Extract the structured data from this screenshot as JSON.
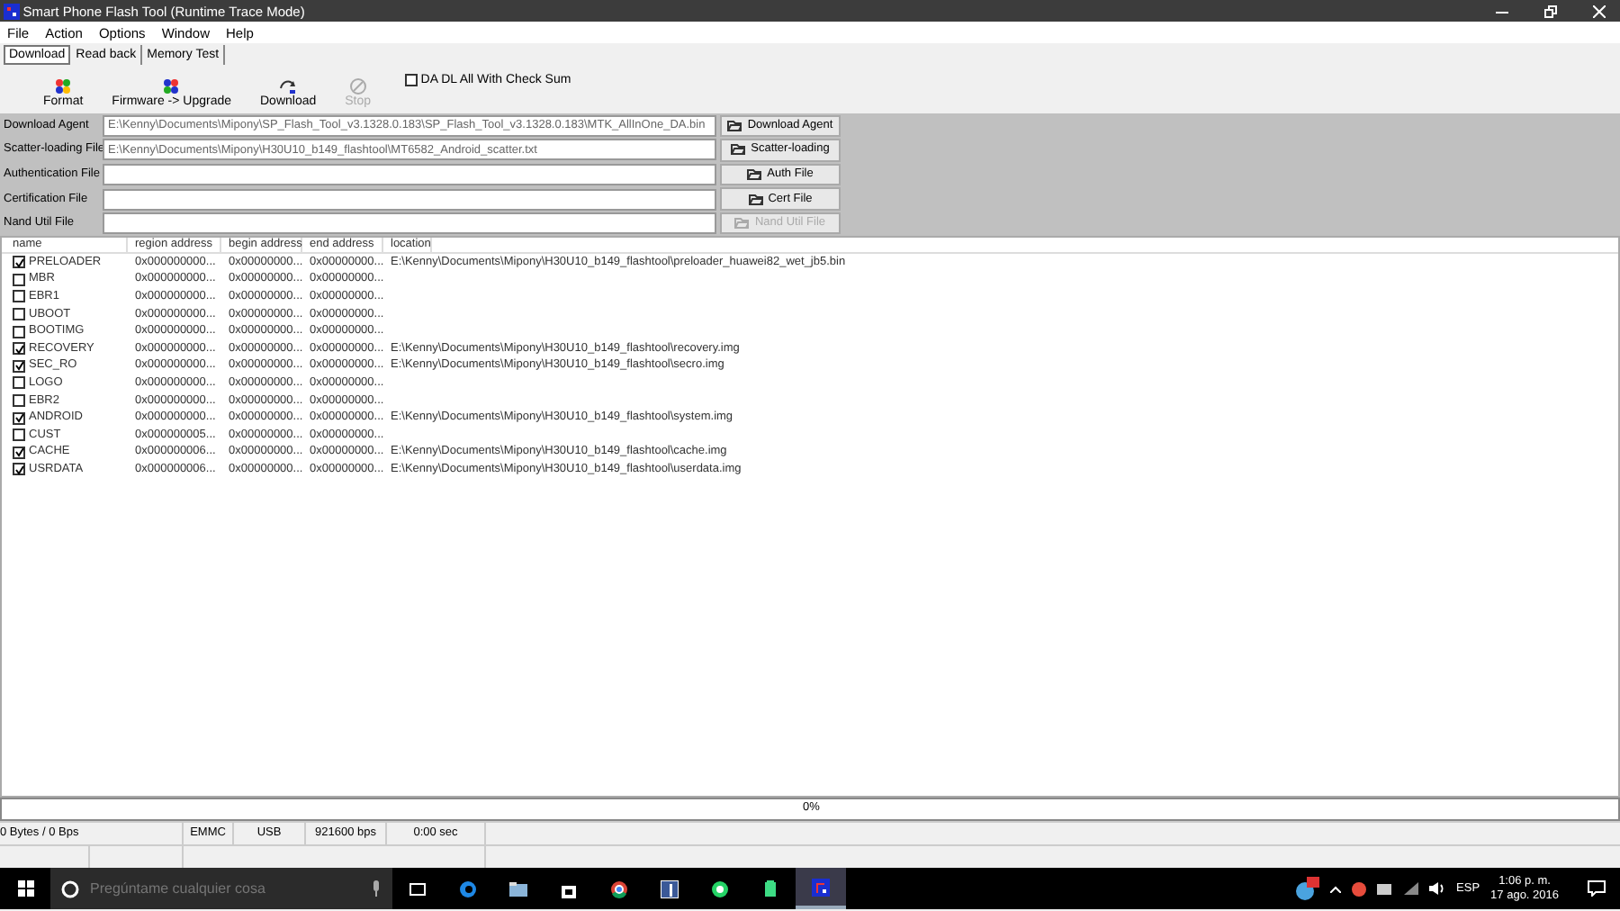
{
  "window": {
    "title": "Smart Phone Flash Tool (Runtime Trace Mode)"
  },
  "menu": [
    "File",
    "Action",
    "Options",
    "Window",
    "Help"
  ],
  "tabs": [
    {
      "label": "Download",
      "selected": true
    },
    {
      "label": "Read back",
      "selected": false
    },
    {
      "label": "Memory Test",
      "selected": false
    }
  ],
  "toolbar": [
    {
      "kind": "format",
      "label": "Format",
      "disabled": false
    },
    {
      "kind": "upgrade",
      "label": "Firmware -> Upgrade",
      "disabled": false
    },
    {
      "kind": "download",
      "label": "Download",
      "disabled": false
    },
    {
      "kind": "stop",
      "label": "Stop",
      "disabled": true
    }
  ],
  "checksum": {
    "label": "DA DL All With Check Sum",
    "checked": false
  },
  "files": [
    {
      "label": "Download Agent",
      "value": "E:\\Kenny\\Documents\\Mipony\\SP_Flash_Tool_v3.1328.0.183\\SP_Flash_Tool_v3.1328.0.183\\MTK_AllInOne_DA.bin",
      "button": "Download Agent",
      "disabled": false
    },
    {
      "label": "Scatter-loading File",
      "value": "E:\\Kenny\\Documents\\Mipony\\H30U10_b149_flashtool\\MT6582_Android_scatter.txt",
      "button": "Scatter-loading",
      "disabled": false
    },
    {
      "label": "Authentication File",
      "button": "Auth File",
      "disabled": false
    },
    {
      "label": "Certification File",
      "button": "Cert File",
      "disabled": false
    },
    {
      "label": "Nand Util File",
      "button": "Nand Util File",
      "disabled": true
    }
  ],
  "table": {
    "columns": [
      "name",
      "region address",
      "begin address",
      "end address",
      "location"
    ],
    "rows": [
      {
        "name": "PRELOADER",
        "checked": true,
        "region": "0x000000000...",
        "begin": "0x00000000...",
        "end": "0x00000000...",
        "location": "E:\\Kenny\\Documents\\Mipony\\H30U10_b149_flashtool\\preloader_huawei82_wet_jb5.bin"
      },
      {
        "name": "MBR",
        "checked": false,
        "region": "0x000000000...",
        "begin": "0x00000000...",
        "end": "0x00000000..."
      },
      {
        "name": "EBR1",
        "checked": false,
        "region": "0x000000000...",
        "begin": "0x00000000...",
        "end": "0x00000000..."
      },
      {
        "name": "UBOOT",
        "checked": false,
        "region": "0x000000000...",
        "begin": "0x00000000...",
        "end": "0x00000000..."
      },
      {
        "name": "BOOTIMG",
        "checked": false,
        "region": "0x000000000...",
        "begin": "0x00000000...",
        "end": "0x00000000..."
      },
      {
        "name": "RECOVERY",
        "checked": true,
        "region": "0x000000000...",
        "begin": "0x00000000...",
        "end": "0x00000000...",
        "location": "E:\\Kenny\\Documents\\Mipony\\H30U10_b149_flashtool\\recovery.img"
      },
      {
        "name": "SEC_RO",
        "checked": true,
        "region": "0x000000000...",
        "begin": "0x00000000...",
        "end": "0x00000000...",
        "location": "E:\\Kenny\\Documents\\Mipony\\H30U10_b149_flashtool\\secro.img"
      },
      {
        "name": "LOGO",
        "checked": false,
        "region": "0x000000000...",
        "begin": "0x00000000...",
        "end": "0x00000000..."
      },
      {
        "name": "EBR2",
        "checked": false,
        "region": "0x000000000...",
        "begin": "0x00000000...",
        "end": "0x00000000..."
      },
      {
        "name": "ANDROID",
        "checked": true,
        "region": "0x000000000...",
        "begin": "0x00000000...",
        "end": "0x00000000...",
        "location": "E:\\Kenny\\Documents\\Mipony\\H30U10_b149_flashtool\\system.img"
      },
      {
        "name": "CUST",
        "checked": false,
        "region": "0x000000005...",
        "begin": "0x00000000...",
        "end": "0x00000000..."
      },
      {
        "name": "CACHE",
        "checked": true,
        "region": "0x000000006...",
        "begin": "0x00000000...",
        "end": "0x00000000...",
        "location": "E:\\Kenny\\Documents\\Mipony\\H30U10_b149_flashtool\\cache.img"
      },
      {
        "name": "USRDATA",
        "checked": true,
        "region": "0x000000006...",
        "begin": "0x00000000...",
        "end": "0x00000000...",
        "location": "E:\\Kenny\\Documents\\Mipony\\H30U10_b149_flashtool\\userdata.img"
      }
    ]
  },
  "progress": {
    "reading": "0%"
  },
  "status_bar": [
    "0 Bytes / 0 Bps",
    "EMMC",
    "USB",
    "921600 bps",
    "0:00 sec"
  ],
  "taskbar": {
    "search": {
      "placeholder": "Pregúntame cualquier cosa"
    },
    "apps": [
      {
        "kind": "taskview",
        "active": false
      },
      {
        "kind": "edge",
        "active": false
      },
      {
        "kind": "explorer",
        "active": false
      },
      {
        "kind": "store",
        "active": false
      },
      {
        "kind": "chrome",
        "active": false
      },
      {
        "kind": "facebook",
        "active": false
      },
      {
        "kind": "whatsapp",
        "active": false
      },
      {
        "kind": "android",
        "active": false
      },
      {
        "kind": "flashtool",
        "active": true
      }
    ],
    "language": "ESP",
    "time": "1:06 p. m.",
    "date": "17 ago. 2016"
  }
}
